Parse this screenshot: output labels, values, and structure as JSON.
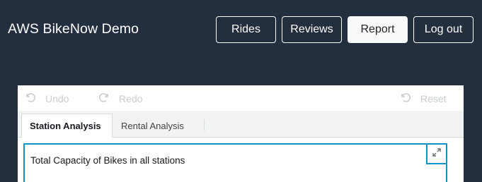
{
  "header": {
    "app_title": "AWS BikeNow Demo",
    "nav": {
      "rides": "Rides",
      "reviews": "Reviews",
      "report": "Report",
      "logout": "Log out"
    },
    "active_nav": "report"
  },
  "dashboard": {
    "toolbar": {
      "undo": "Undo",
      "redo": "Redo",
      "reset": "Reset"
    },
    "tabs": [
      {
        "label": "Station Analysis",
        "active": true
      },
      {
        "label": "Rental Analysis",
        "active": false
      }
    ],
    "visual": {
      "title": "Total Capacity of Bikes in all stations"
    }
  },
  "colors": {
    "header_bg": "#232f3e",
    "accent": "#0a93c4",
    "disabled_text": "#c8cdd2"
  },
  "icons": [
    "undo-icon",
    "redo-icon",
    "reset-icon",
    "expand-icon"
  ]
}
